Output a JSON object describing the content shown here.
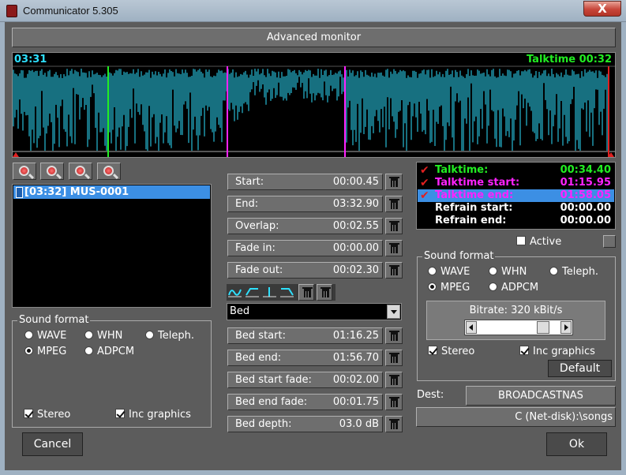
{
  "window": {
    "title": "Communicator 5.305",
    "close_label": "X"
  },
  "header": {
    "title": "Advanced monitor"
  },
  "waveform": {
    "left_time": "03:31",
    "right_label": "Talktime 00:32",
    "wave_color": "#2ee0ff"
  },
  "zoom_icons": [
    "zoom-fit-icon",
    "zoom-out-icon",
    "zoom-in-icon",
    "zoom-max-icon"
  ],
  "playlist": {
    "items": [
      {
        "label": "[03:32] MUS-0001"
      }
    ]
  },
  "left_sound_format": {
    "title": "Sound format",
    "options": [
      "WAVE",
      "WHN",
      "Teleph.",
      "MPEG",
      "ADPCM"
    ],
    "selected": "MPEG",
    "stereo_label": "Stereo",
    "stereo_checked": true,
    "incgfx_label": "Inc graphics",
    "incgfx_checked": true
  },
  "fields": [
    {
      "label": "Start:",
      "value": "00:00.45"
    },
    {
      "label": "End:",
      "value": "03:32.90"
    },
    {
      "label": "Overlap:",
      "value": "00:02.55"
    },
    {
      "label": "Fade in:",
      "value": "00:00.00"
    },
    {
      "label": "Fade out:",
      "value": "00:02.30"
    }
  ],
  "bed": {
    "selected": "Bed",
    "fields": [
      {
        "label": "Bed start:",
        "value": "01:16.25"
      },
      {
        "label": "Bed end:",
        "value": "01:56.70"
      },
      {
        "label": "Bed start fade:",
        "value": "00:02.00"
      },
      {
        "label": "Bed end fade:",
        "value": "00:01.75"
      },
      {
        "label": "Bed depth:",
        "value": "03.0 dB"
      }
    ]
  },
  "talktime": {
    "rows": [
      {
        "label": "Talktime:",
        "value": "00:34.40",
        "color": "#22ee22",
        "checked": true
      },
      {
        "label": "Talktime start:",
        "value": "01:15.95",
        "color": "#ff22ff",
        "checked": true
      },
      {
        "label": "Talktime end:",
        "value": "01:58.05",
        "color": "#ff22ff",
        "checked": true,
        "highlighted": true
      },
      {
        "label": "Refrain start:",
        "value": "00:00.00",
        "color": "#ffffff",
        "checked": false
      },
      {
        "label": "Refrain end:",
        "value": "00:00.00",
        "color": "#ffffff",
        "checked": false
      }
    ]
  },
  "active": {
    "label": "Active",
    "checked": false
  },
  "right_sound_format": {
    "title": "Sound format",
    "options": [
      "WAVE",
      "WHN",
      "Teleph.",
      "MPEG",
      "ADPCM"
    ],
    "selected": "MPEG",
    "bitrate_label": "Bitrate: 320 kBit/s",
    "bitrate_fraction": 0.85,
    "stereo_label": "Stereo",
    "stereo_checked": true,
    "incgfx_label": "Inc graphics",
    "incgfx_checked": true,
    "default_label": "Default"
  },
  "dest": {
    "label": "Dest:",
    "value": "BROADCASTNAS",
    "path": "C (Net-disk):\\songs"
  },
  "buttons": {
    "cancel": "Cancel",
    "ok": "Ok"
  }
}
